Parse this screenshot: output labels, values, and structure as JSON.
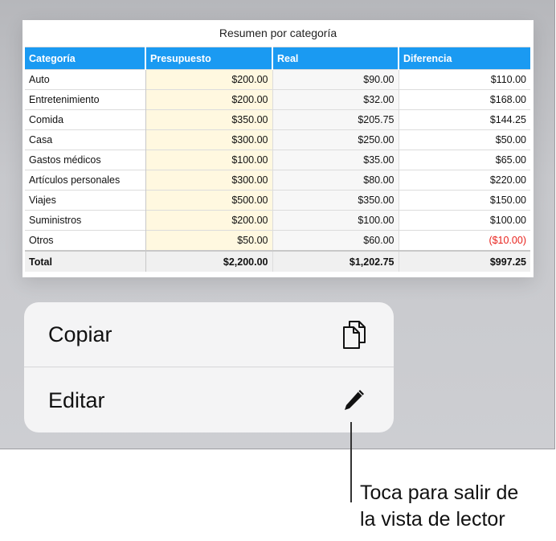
{
  "table": {
    "title": "Resumen por categoría",
    "headers": [
      "Categoría",
      "Presupuesto",
      "Real",
      "Diferencia"
    ],
    "rows": [
      {
        "category": "Auto",
        "budget": "$200.00",
        "actual": "$90.00",
        "difference": "$110.00"
      },
      {
        "category": "Entretenimiento",
        "budget": "$200.00",
        "actual": "$32.00",
        "difference": "$168.00"
      },
      {
        "category": "Comida",
        "budget": "$350.00",
        "actual": "$205.75",
        "difference": "$144.25"
      },
      {
        "category": "Casa",
        "budget": "$300.00",
        "actual": "$250.00",
        "difference": "$50.00"
      },
      {
        "category": "Gastos médicos",
        "budget": "$100.00",
        "actual": "$35.00",
        "difference": "$65.00"
      },
      {
        "category": "Artículos personales",
        "budget": "$300.00",
        "actual": "$80.00",
        "difference": "$220.00"
      },
      {
        "category": "Viajes",
        "budget": "$500.00",
        "actual": "$350.00",
        "difference": "$150.00"
      },
      {
        "category": "Suministros",
        "budget": "$200.00",
        "actual": "$100.00",
        "difference": "$100.00"
      },
      {
        "category": "Otros",
        "budget": "$50.00",
        "actual": "$60.00",
        "difference": "($10.00)"
      }
    ],
    "total": {
      "category": "Total",
      "budget": "$2,200.00",
      "actual": "$1,202.75",
      "difference": "$997.25"
    }
  },
  "menu": {
    "copy_label": "Copiar",
    "copy_icon": "copy-icon",
    "edit_label": "Editar",
    "edit_icon": "pencil-icon"
  },
  "callout": {
    "line1": "Toca para salir de",
    "line2": "la vista de lector"
  },
  "colors": {
    "header_blue": "#1a9af2",
    "negative_red": "#e8221c",
    "budget_fill": "#fff8e0"
  }
}
